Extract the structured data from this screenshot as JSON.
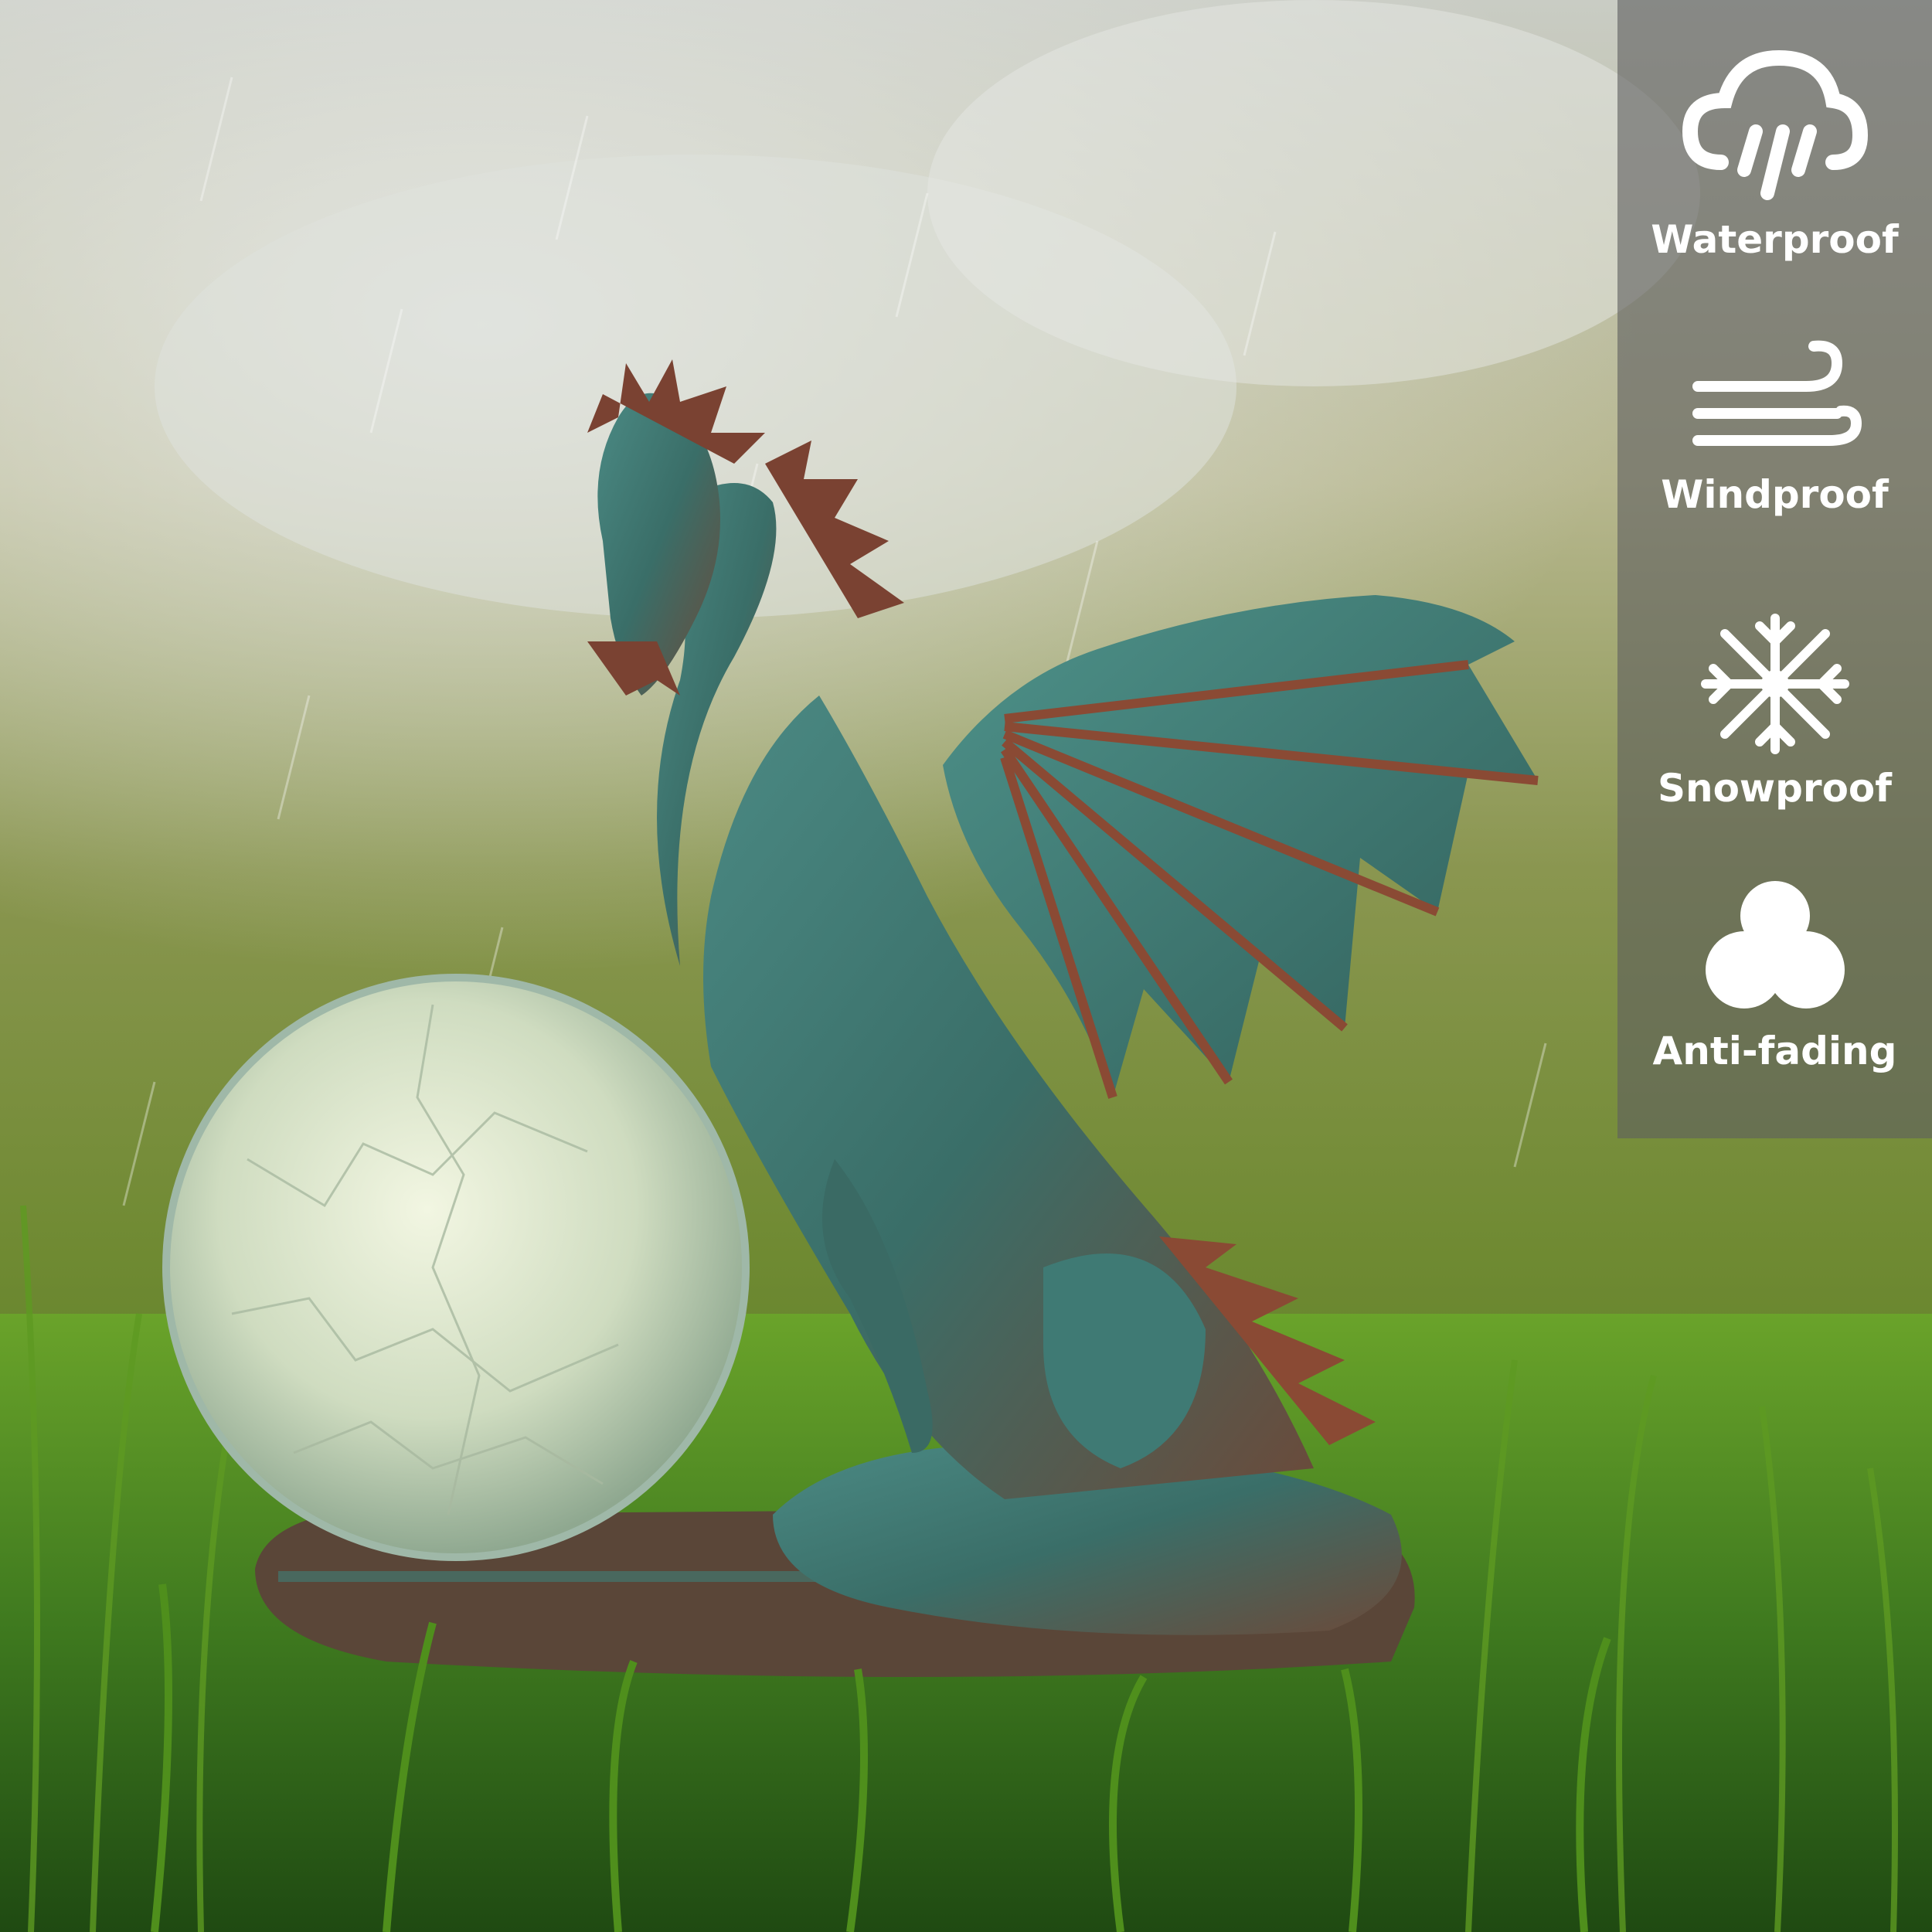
{
  "features": [
    {
      "label": "Waterproof",
      "icon": "rain-cloud-icon"
    },
    {
      "label": "Windproof",
      "icon": "wind-icon"
    },
    {
      "label": "Snowproof",
      "icon": "snowflake-icon"
    },
    {
      "label": "Anti-fading",
      "icon": "tri-circle-icon"
    }
  ],
  "colors": {
    "panel": "#5f5f5f",
    "text": "#ffffff",
    "grass": "#3f7a1f",
    "dragon_patina": "#3f7f78",
    "dragon_copper": "#8a4a34"
  }
}
